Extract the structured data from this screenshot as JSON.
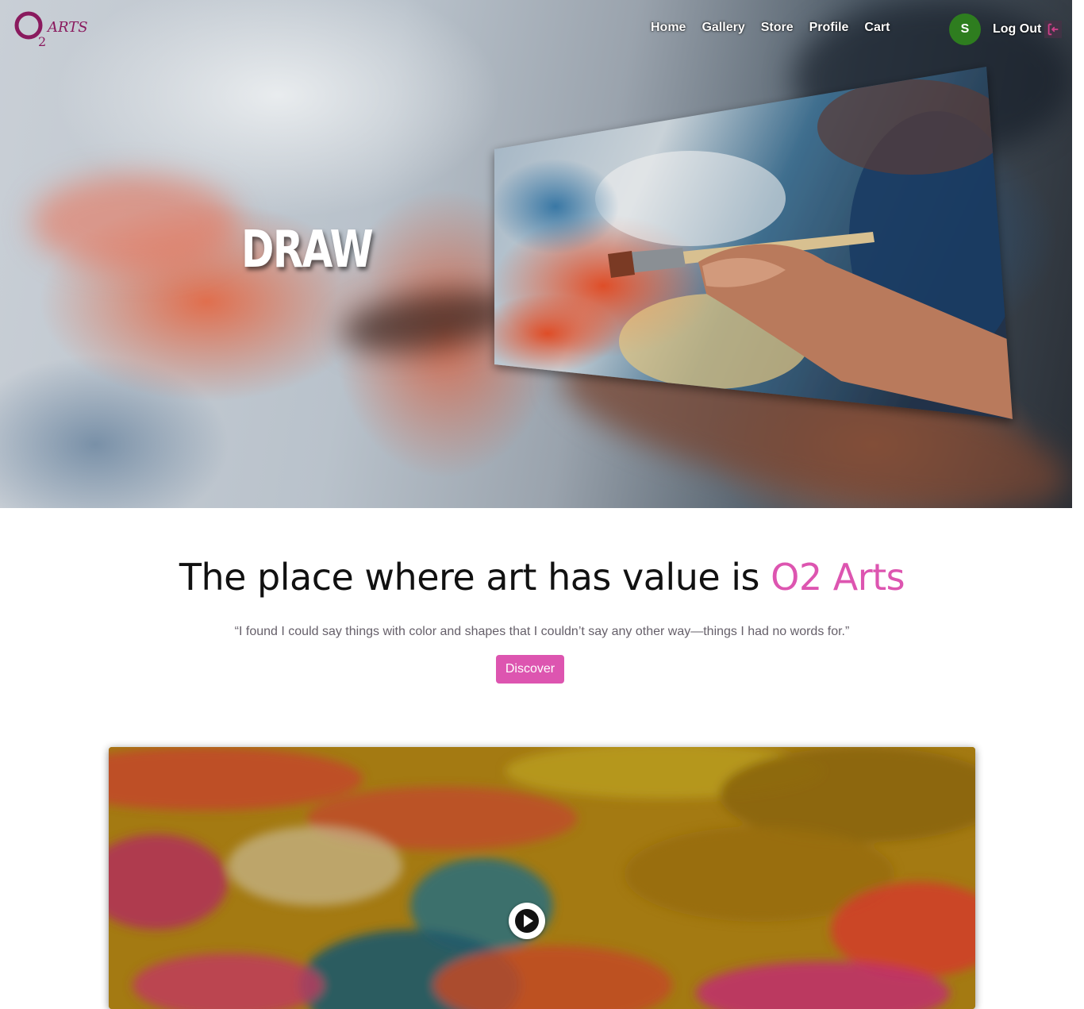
{
  "brand": {
    "logo_text": "O2 ARTS",
    "accent_color": "#dd55b0",
    "logo_color": "#8a1a5e"
  },
  "nav": {
    "items": [
      {
        "label": "Home"
      },
      {
        "label": "Gallery"
      },
      {
        "label": "Store"
      },
      {
        "label": "Profile"
      },
      {
        "label": "Cart"
      }
    ],
    "avatar_initial": "S",
    "avatar_color": "#2e7d1f",
    "logout_label": "Log Out",
    "logout_icon": "logout-icon"
  },
  "hero": {
    "word": "DRAW"
  },
  "intro": {
    "headline_prefix": "The place where art has value is ",
    "headline_brand": "O2 Arts",
    "quote": "“I found I could say things with color and shapes that I couldn’t say any other way—things I had no words for.”",
    "cta_label": "Discover"
  },
  "video": {
    "play_icon": "play-icon"
  }
}
